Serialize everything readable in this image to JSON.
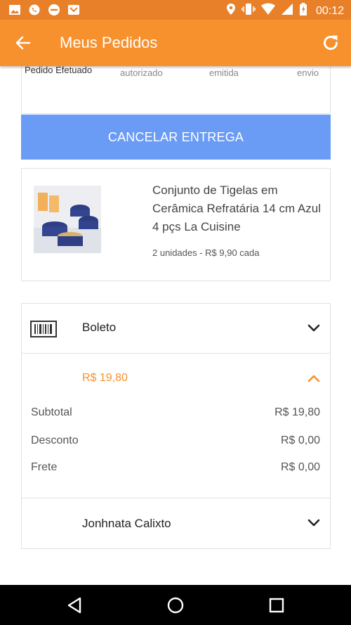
{
  "status_bar": {
    "time": "00:12",
    "left_icons": [
      "image-icon",
      "whatsapp-icon",
      "do-not-disturb-icon",
      "notification-icon"
    ],
    "right_icons": [
      "location-icon",
      "vibrate-icon",
      "wifi-icon",
      "signal-icon",
      "battery-icon"
    ]
  },
  "app_bar": {
    "title": "Meus Pedidos",
    "background": "#f7912d"
  },
  "progress_steps": [
    {
      "label": "Pedido Efetuado"
    },
    {
      "label": "autorizado"
    },
    {
      "label": "emitida"
    },
    {
      "label": "envio"
    }
  ],
  "cancel_button": {
    "label": "CANCELAR ENTREGA",
    "color": "#6a9cf6"
  },
  "product": {
    "name": "Conjunto de Tigelas em Cerâmica Refratária 14 cm Azul 4 pçs La Cuisine",
    "quantity_text": "2 unidades - R$ 9,90 cada"
  },
  "payment": {
    "method": "Boleto",
    "total": "R$ 19,80",
    "lines": [
      {
        "label": "Subtotal",
        "value": "R$ 19,80"
      },
      {
        "label": "Desconto",
        "value": "R$ 0,00"
      },
      {
        "label": "Frete",
        "value": "R$ 0,00"
      }
    ]
  },
  "recipient": {
    "name": "Jonhnata Calixto"
  }
}
